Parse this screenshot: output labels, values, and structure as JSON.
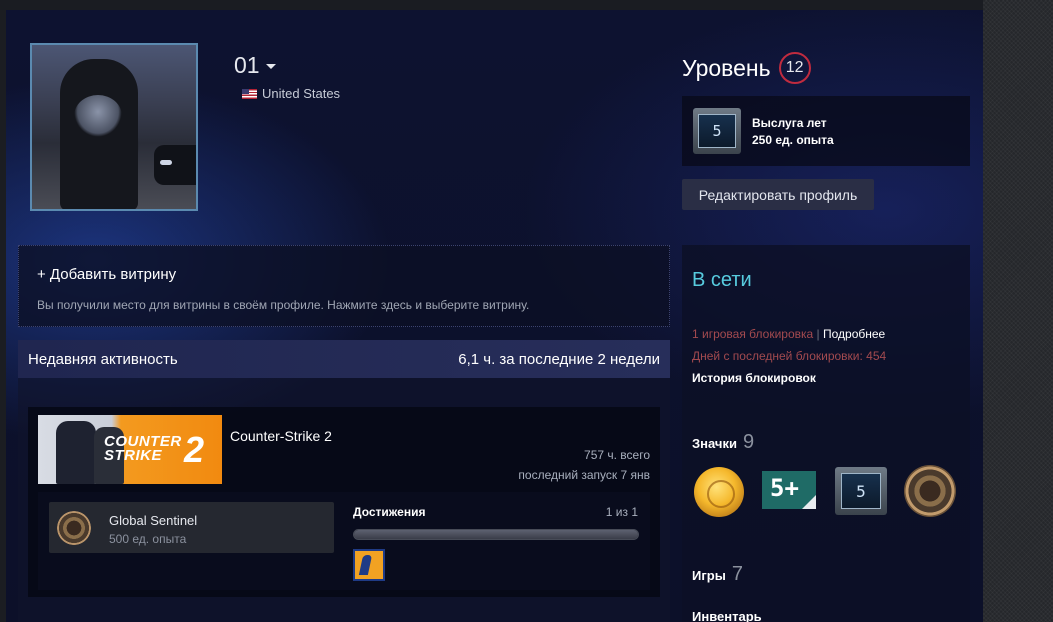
{
  "profile": {
    "username": "01",
    "country": "United States"
  },
  "level": {
    "label": "Уровень",
    "value": "12"
  },
  "years_badge": {
    "number": "5",
    "name": "Выслуга лет",
    "xp": "250 ед. опыта"
  },
  "edit_profile_label": "Редактировать профиль",
  "showcase": {
    "title": "+ Добавить витрину",
    "description": "Вы получили место для витрины в своём профиле. Нажмите здесь и выберите витрину."
  },
  "activity": {
    "label": "Недавняя активность",
    "hours": "6,1 ч. за последние 2 недели",
    "game": {
      "name": "Counter-Strike 2",
      "capsule_text_line1": "COUNTER",
      "capsule_text_line2": "STRIKE",
      "capsule_number": "2",
      "total_hours": "757 ч. всего",
      "last_played": "последний запуск 7 янв",
      "badge_name": "Global Sentinel",
      "badge_xp": "500 ед. опыта",
      "achievements_label": "Достижения",
      "achievements_count": "1 из 1",
      "achievements_progress": 1.0
    }
  },
  "status": {
    "online": "В сети",
    "ban_text": "1 игровая блокировка",
    "ban_sep": " | ",
    "ban_more": "Подробнее",
    "ban_days": "Дней с последней блокировки: 454",
    "ban_history": "История блокировок",
    "badges_label": "Значки",
    "badges_count": "9",
    "badge_five_text": "5+",
    "badge_years_text": "5",
    "games_label": "Игры",
    "games_count": "7",
    "inventory_label": "Инвентарь"
  },
  "colors": {
    "online": "#57cbde",
    "ban": "#a34a4f",
    "level_ring": "#c02b3f"
  },
  "icons": {
    "flag": "us-flag-icon",
    "caret": "chevron-down-icon"
  }
}
